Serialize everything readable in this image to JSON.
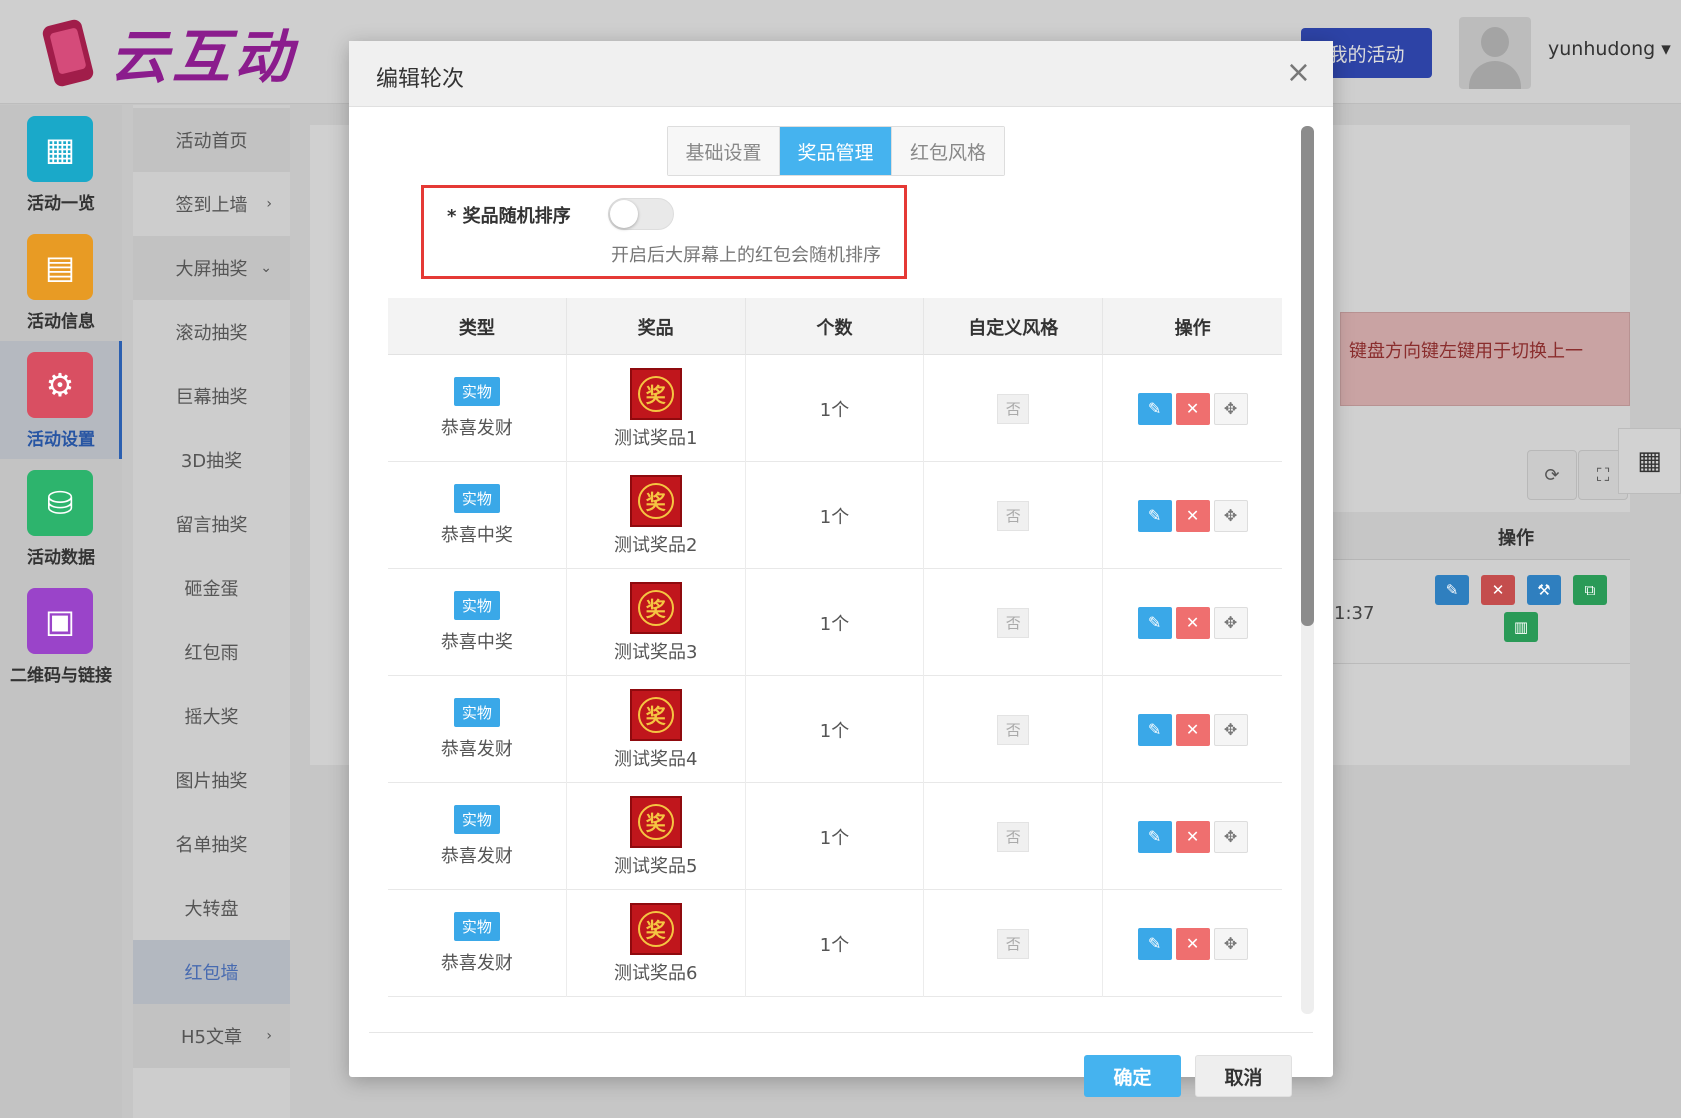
{
  "app": {
    "logo_text": "云互动",
    "my_activities": "我的活动",
    "username": "yunhudong ▾"
  },
  "icon_nav": [
    {
      "label": "活动一览",
      "color": "#1aa9c9",
      "icon": "grid-icon"
    },
    {
      "label": "活动信息",
      "color": "#e89b24",
      "icon": "document-icon"
    },
    {
      "label": "活动设置",
      "color": "#d94f62",
      "icon": "gear-icon"
    },
    {
      "label": "活动数据",
      "color": "#2db46d",
      "icon": "database-icon"
    },
    {
      "label": "二维码与链接",
      "color": "#9a44c9",
      "icon": "qrcode-icon"
    }
  ],
  "menu": [
    {
      "label": "活动首页"
    },
    {
      "label": "签到上墙",
      "arrow": "›"
    },
    {
      "label": "大屏抽奖",
      "arrow": "⌄"
    },
    {
      "label": "滚动抽奖"
    },
    {
      "label": "巨幕抽奖"
    },
    {
      "label": "3D抽奖"
    },
    {
      "label": "留言抽奖"
    },
    {
      "label": "砸金蛋"
    },
    {
      "label": "红包雨"
    },
    {
      "label": "摇大奖"
    },
    {
      "label": "图片抽奖"
    },
    {
      "label": "名单抽奖"
    },
    {
      "label": "大转盘"
    },
    {
      "label": "红包墙"
    },
    {
      "label": "H5文章",
      "arrow": "›"
    }
  ],
  "background": {
    "alert_text": "键盘方向键左键用于切换上一",
    "ops_header": "操作",
    "row_time": "1:37"
  },
  "modal": {
    "title": "编辑轮次",
    "close": "×",
    "tabs": [
      "基础设置",
      "奖品管理",
      "红包风格"
    ],
    "random_sort": {
      "label": "* 奖品随机排序",
      "enabled": false,
      "help": "开启后大屏幕上的红包会随机排序"
    },
    "table": {
      "headers": [
        "类型",
        "奖品",
        "个数",
        "自定义风格",
        "操作"
      ],
      "rows": [
        {
          "badge": "实物",
          "type_name": "恭喜发财",
          "prize_icon": "奖",
          "prize_name": "测试奖品1",
          "count": "1个",
          "custom_style": "否"
        },
        {
          "badge": "实物",
          "type_name": "恭喜中奖",
          "prize_icon": "奖",
          "prize_name": "测试奖品2",
          "count": "1个",
          "custom_style": "否"
        },
        {
          "badge": "实物",
          "type_name": "恭喜中奖",
          "prize_icon": "奖",
          "prize_name": "测试奖品3",
          "count": "1个",
          "custom_style": "否"
        },
        {
          "badge": "实物",
          "type_name": "恭喜发财",
          "prize_icon": "奖",
          "prize_name": "测试奖品4",
          "count": "1个",
          "custom_style": "否"
        },
        {
          "badge": "实物",
          "type_name": "恭喜发财",
          "prize_icon": "奖",
          "prize_name": "测试奖品5",
          "count": "1个",
          "custom_style": "否"
        },
        {
          "badge": "实物",
          "type_name": "恭喜发财",
          "prize_icon": "奖",
          "prize_name": "测试奖品6",
          "count": "1个",
          "custom_style": "否"
        }
      ]
    },
    "confirm": "确定",
    "cancel": "取消"
  }
}
